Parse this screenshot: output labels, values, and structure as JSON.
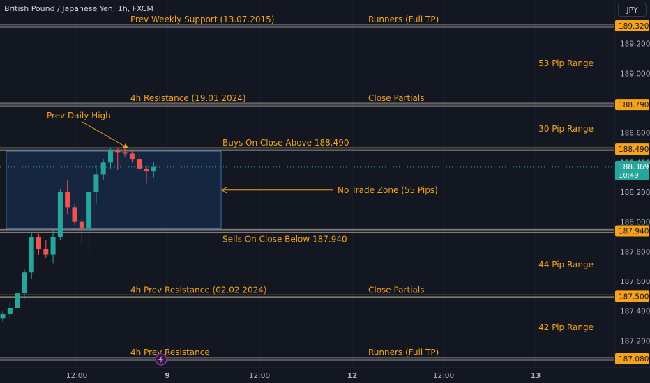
{
  "header": {
    "symbol_title": "British Pound / Japanese Yen, 1h, FXCM",
    "currency": "JPY"
  },
  "colors": {
    "background": "#131722",
    "grid": "#1e222d",
    "up": "#26a69a",
    "down": "#ef5350",
    "level_line": "#787b86",
    "level_label": "#f7a21b",
    "price_badge": "#f7a21b",
    "current_badge": "#26a69a",
    "zone_fill": "#1b3a66",
    "zone_border": "#3a6ea5"
  },
  "price_axis": {
    "ticks": [
      "189.200",
      "189.000",
      "188.600",
      "188.400",
      "188.200",
      "188.000",
      "187.800",
      "187.600",
      "187.400",
      "187.200"
    ],
    "current_price": "188.369",
    "countdown": "10:49"
  },
  "time_axis": {
    "ticks": [
      "12:00",
      "9",
      "12:00",
      "12",
      "12:00",
      "13"
    ]
  },
  "levels": [
    {
      "price": 189.32,
      "badge": "189.320",
      "left_label": "Prev Weekly Support (13.07.2015)",
      "right_label": "Runners (Full TP)"
    },
    {
      "price": 188.79,
      "badge": "188.790",
      "left_label": "4h Resistance (19.01.2024)",
      "right_label": "Close Partials"
    },
    {
      "price": 188.49,
      "badge": "188.490",
      "left_label": "Buys On Close Above 188.490",
      "right_label": ""
    },
    {
      "price": 187.94,
      "badge": "187.940",
      "left_label": "Sells On Close Below 187.940",
      "right_label": ""
    },
    {
      "price": 187.5,
      "badge": "187.500",
      "left_label": "4h Prev Resistance (02.02.2024)",
      "right_label": "Close Partials"
    },
    {
      "price": 187.08,
      "badge": "187.080",
      "left_label": "4h Prev Resistance",
      "right_label": "Runners (Full TP)"
    }
  ],
  "ranges": [
    "53 Pip Range",
    "30 Pip Range",
    "44 Pip Range",
    "42 Pip Range"
  ],
  "annotations": {
    "prev_daily_high": "Prev Daily High",
    "no_trade_zone": "No Trade Zone (55 Pips)"
  },
  "chart_data": {
    "type": "candlestick",
    "title": "British Pound / Japanese Yen, 1h, FXCM",
    "y_unit": "JPY",
    "ylim": [
      187.0,
      189.4
    ],
    "candles": [
      {
        "o": 187.35,
        "h": 187.4,
        "l": 187.33,
        "c": 187.38
      },
      {
        "o": 187.38,
        "h": 187.46,
        "l": 187.35,
        "c": 187.42
      },
      {
        "o": 187.42,
        "h": 187.55,
        "l": 187.37,
        "c": 187.52
      },
      {
        "o": 187.52,
        "h": 187.68,
        "l": 187.48,
        "c": 187.66
      },
      {
        "o": 187.66,
        "h": 187.93,
        "l": 187.62,
        "c": 187.9
      },
      {
        "o": 187.9,
        "h": 187.92,
        "l": 187.78,
        "c": 187.82
      },
      {
        "o": 187.82,
        "h": 187.88,
        "l": 187.76,
        "c": 187.78
      },
      {
        "o": 187.78,
        "h": 187.95,
        "l": 187.72,
        "c": 187.9
      },
      {
        "o": 187.9,
        "h": 188.22,
        "l": 187.88,
        "c": 188.2
      },
      {
        "o": 188.2,
        "h": 188.28,
        "l": 188.05,
        "c": 188.1
      },
      {
        "o": 188.1,
        "h": 188.12,
        "l": 187.98,
        "c": 188.0
      },
      {
        "o": 188.0,
        "h": 188.02,
        "l": 187.85,
        "c": 187.96
      },
      {
        "o": 187.96,
        "h": 188.22,
        "l": 187.8,
        "c": 188.2
      },
      {
        "o": 188.2,
        "h": 188.38,
        "l": 188.12,
        "c": 188.32
      },
      {
        "o": 188.32,
        "h": 188.42,
        "l": 188.28,
        "c": 188.4
      },
      {
        "o": 188.4,
        "h": 188.5,
        "l": 188.36,
        "c": 188.48
      },
      {
        "o": 188.48,
        "h": 188.5,
        "l": 188.35,
        "c": 188.47
      },
      {
        "o": 188.47,
        "h": 188.5,
        "l": 188.44,
        "c": 188.46
      },
      {
        "o": 188.46,
        "h": 188.48,
        "l": 188.4,
        "c": 188.42
      },
      {
        "o": 188.42,
        "h": 188.45,
        "l": 188.34,
        "c": 188.36
      },
      {
        "o": 188.36,
        "h": 188.38,
        "l": 188.26,
        "c": 188.34
      },
      {
        "o": 188.34,
        "h": 188.4,
        "l": 188.3,
        "c": 188.37
      }
    ]
  }
}
